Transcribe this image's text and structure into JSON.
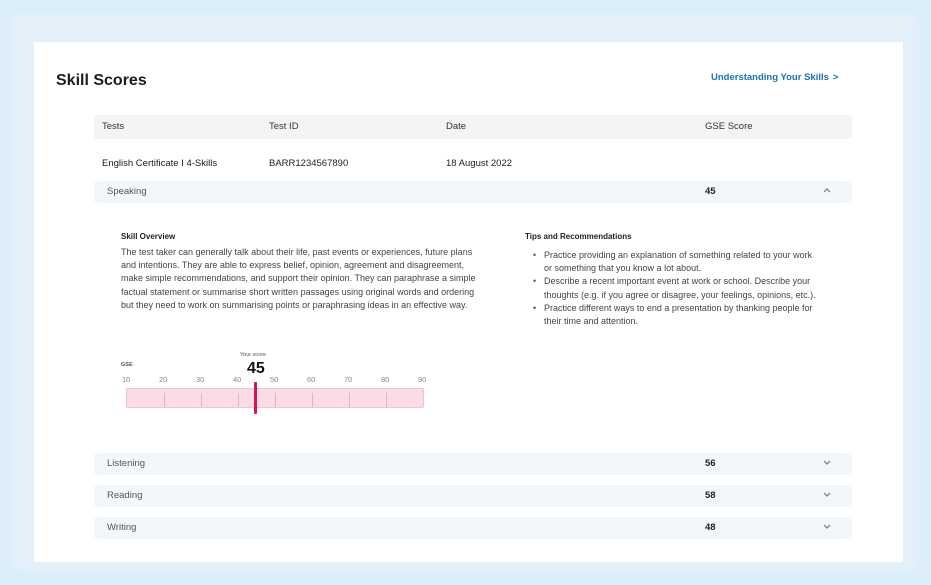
{
  "header": {
    "title": "Skill Scores",
    "link_label": "Understanding Your Skills",
    "link_chevron": ">"
  },
  "table": {
    "columns": [
      "Tests",
      "Test ID",
      "Date",
      "GSE Score"
    ],
    "test": {
      "name": "English Certificate I 4-Skills",
      "id": "BARR1234567890",
      "date": "18 August 2022"
    }
  },
  "skills": [
    {
      "name": "Speaking",
      "score": "45",
      "chevron": "^",
      "expanded": true
    },
    {
      "name": "Listening",
      "score": "56",
      "chevron": "v",
      "expanded": false
    },
    {
      "name": "Reading",
      "score": "58",
      "chevron": "v",
      "expanded": false
    },
    {
      "name": "Writing",
      "score": "48",
      "chevron": "v",
      "expanded": false
    }
  ],
  "detail": {
    "overview_title": "Skill Overview",
    "overview_text": "The test taker can generally talk about their life, past events or experiences, future plans and intentions. They are able to express belief, opinion, agreement and disagreement, make simple recommendations, and support their opinion. They can paraphrase a simple factual statement or summarise short written passages using original words and ordering but they need to work on summarising points or paraphrasing ideas in an effective way.",
    "tips_title": "Tips and Recommendations",
    "tips": [
      "Practice providing an explanation of something related to your work or something that you know a lot about.",
      "Describe a recent important event at work or school. Describe your thoughts (e.g. if you agree or disagree, your feelings, opinions, etc.).",
      "Practice different ways to end a presentation by thanking people for their time and attention."
    ],
    "scale": {
      "label": "GSE",
      "your_score_label": "Your score",
      "your_score": "45",
      "score_value": 45,
      "min": 10,
      "max": 90,
      "ticks": [
        "10",
        "20",
        "30",
        "40",
        "50",
        "60",
        "70",
        "80",
        "90"
      ]
    }
  },
  "colors": {
    "background": "#dceefa",
    "link": "#1f6fb3",
    "marker": "#d4145a",
    "bar_fill": "#f9dce6",
    "row_tint": "#f3f6fb"
  },
  "icons": {
    "link_chevron": "chevron-right-icon",
    "expanded_chevron": "chevron-up-icon",
    "collapsed_chevron": "chevron-down-icon"
  }
}
